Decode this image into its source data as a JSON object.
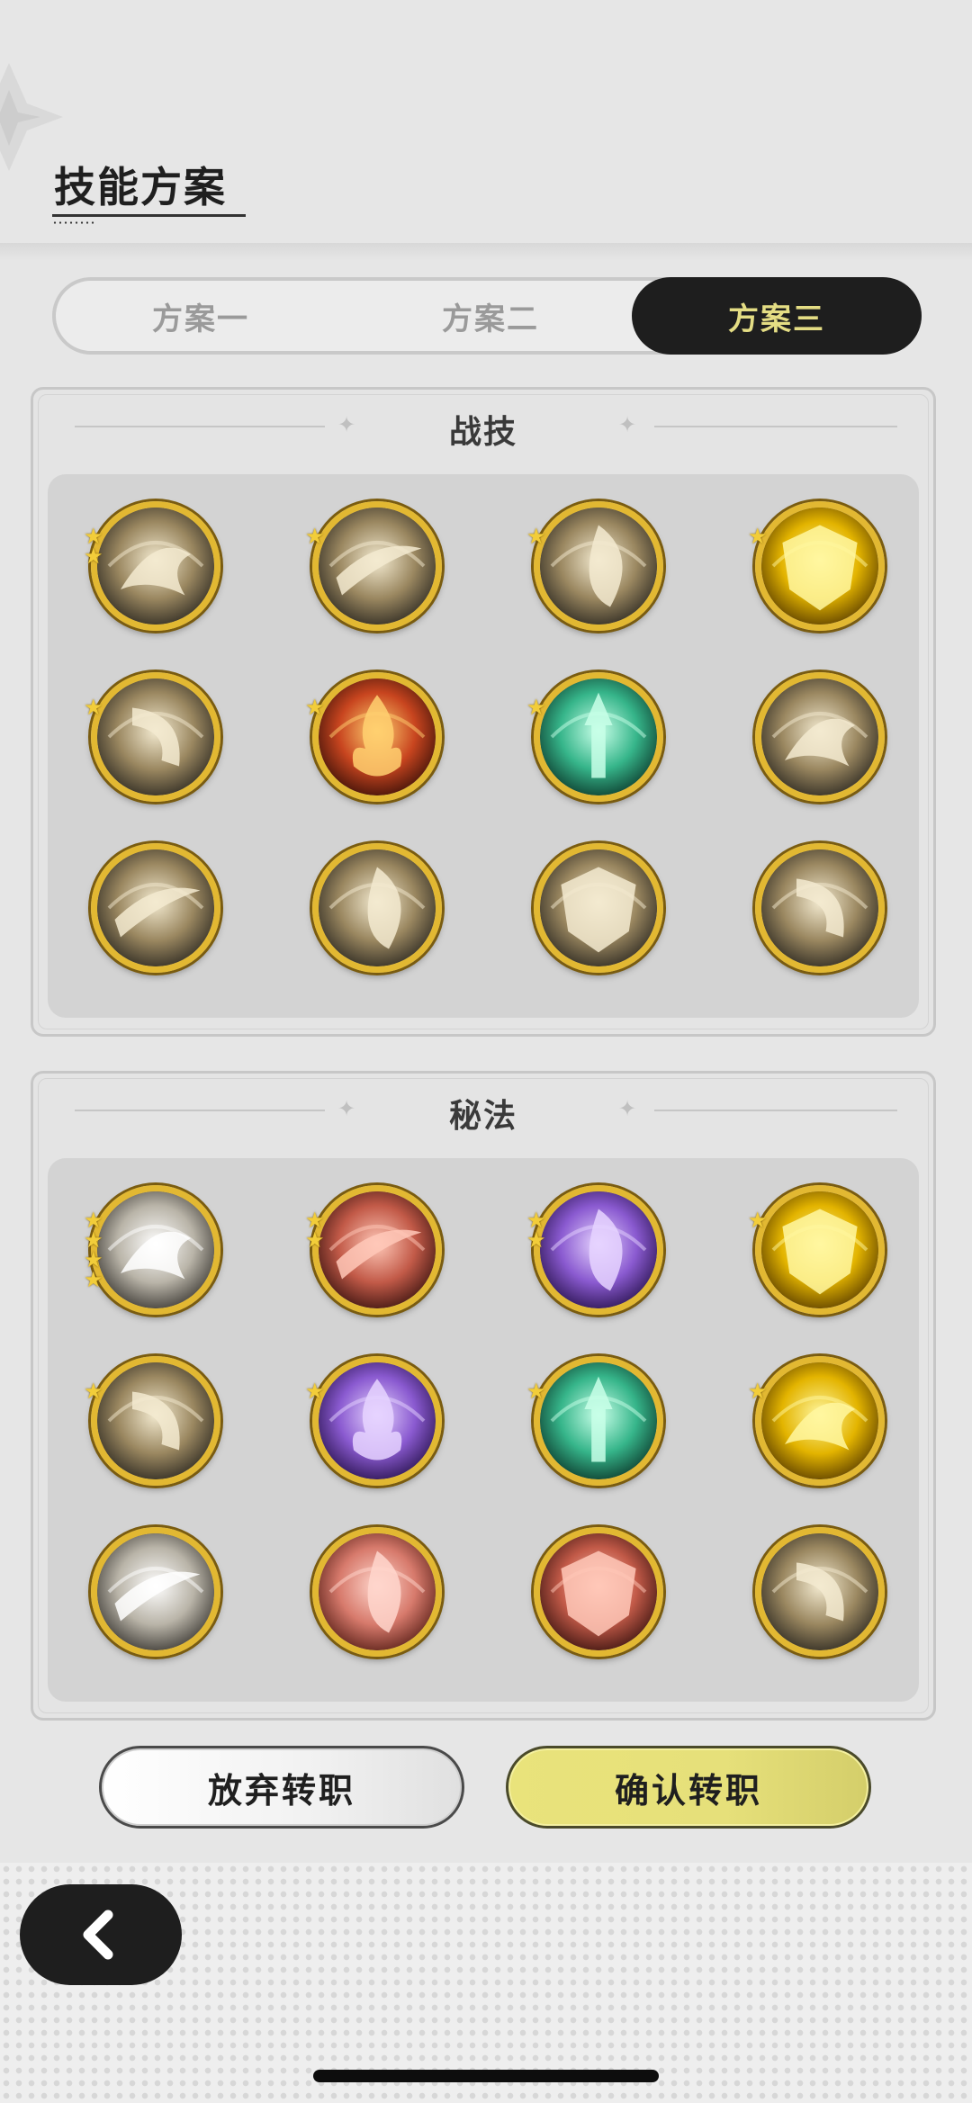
{
  "header": {
    "title": "技能方案"
  },
  "tabs": [
    {
      "label": "方案一",
      "active": false
    },
    {
      "label": "方案二",
      "active": false
    },
    {
      "label": "方案三",
      "active": true
    }
  ],
  "sections": {
    "combat": {
      "title": "战技",
      "skills": [
        {
          "icon": "gripping-hand-wind-icon",
          "stars": 2,
          "theme": "bronze"
        },
        {
          "icon": "wind-slash-icon",
          "stars": 1,
          "theme": "bronze"
        },
        {
          "icon": "swirl-blade-icon",
          "stars": 1,
          "theme": "bronze"
        },
        {
          "icon": "golden-shield-up-icon",
          "stars": 1,
          "theme": "gold"
        },
        {
          "icon": "claw-slash-icon",
          "stars": 1,
          "theme": "bronze"
        },
        {
          "icon": "flame-icon",
          "stars": 1,
          "theme": "fire"
        },
        {
          "icon": "green-aura-up-icon",
          "stars": 1,
          "theme": "green"
        },
        {
          "icon": "sword-burst-icon",
          "stars": 0,
          "theme": "bronze"
        },
        {
          "icon": "whirlwind-icon",
          "stars": 0,
          "theme": "bronze"
        },
        {
          "icon": "ground-explosion-icon",
          "stars": 0,
          "theme": "bronze"
        },
        {
          "icon": "pillar-burst-icon",
          "stars": 0,
          "theme": "bronze"
        },
        {
          "icon": "lightning-slash-icon",
          "stars": 0,
          "theme": "bronze"
        }
      ]
    },
    "arcane": {
      "title": "秘法",
      "skills": [
        {
          "icon": "leaf-emblem-icon",
          "stars": 4,
          "theme": "silver"
        },
        {
          "icon": "red-fist-icon",
          "stars": 2,
          "theme": "red"
        },
        {
          "icon": "purple-figure-icon",
          "stars": 2,
          "theme": "purple"
        },
        {
          "icon": "golden-guardians-icon",
          "stars": 1,
          "theme": "gold"
        },
        {
          "icon": "gold-compass-icon",
          "stars": 1,
          "theme": "bronze"
        },
        {
          "icon": "purple-beast-icon",
          "stars": 1,
          "theme": "purple"
        },
        {
          "icon": "green-sword-icon",
          "stars": 1,
          "theme": "green"
        },
        {
          "icon": "gold-heal-figure-icon",
          "stars": 1,
          "theme": "gold"
        },
        {
          "icon": "silver-crystal-icon",
          "stars": 0,
          "theme": "silver"
        },
        {
          "icon": "red-sword-plus-icon",
          "stars": 0,
          "theme": "pink"
        },
        {
          "icon": "red-armor-icon",
          "stars": 0,
          "theme": "red"
        },
        {
          "icon": "bronze-beast-icon",
          "stars": 0,
          "theme": "bronze"
        }
      ]
    }
  },
  "buttons": {
    "abandon": "放弃转职",
    "confirm": "确认转职"
  },
  "nav": {
    "back_icon": "chevron-left-icon"
  }
}
